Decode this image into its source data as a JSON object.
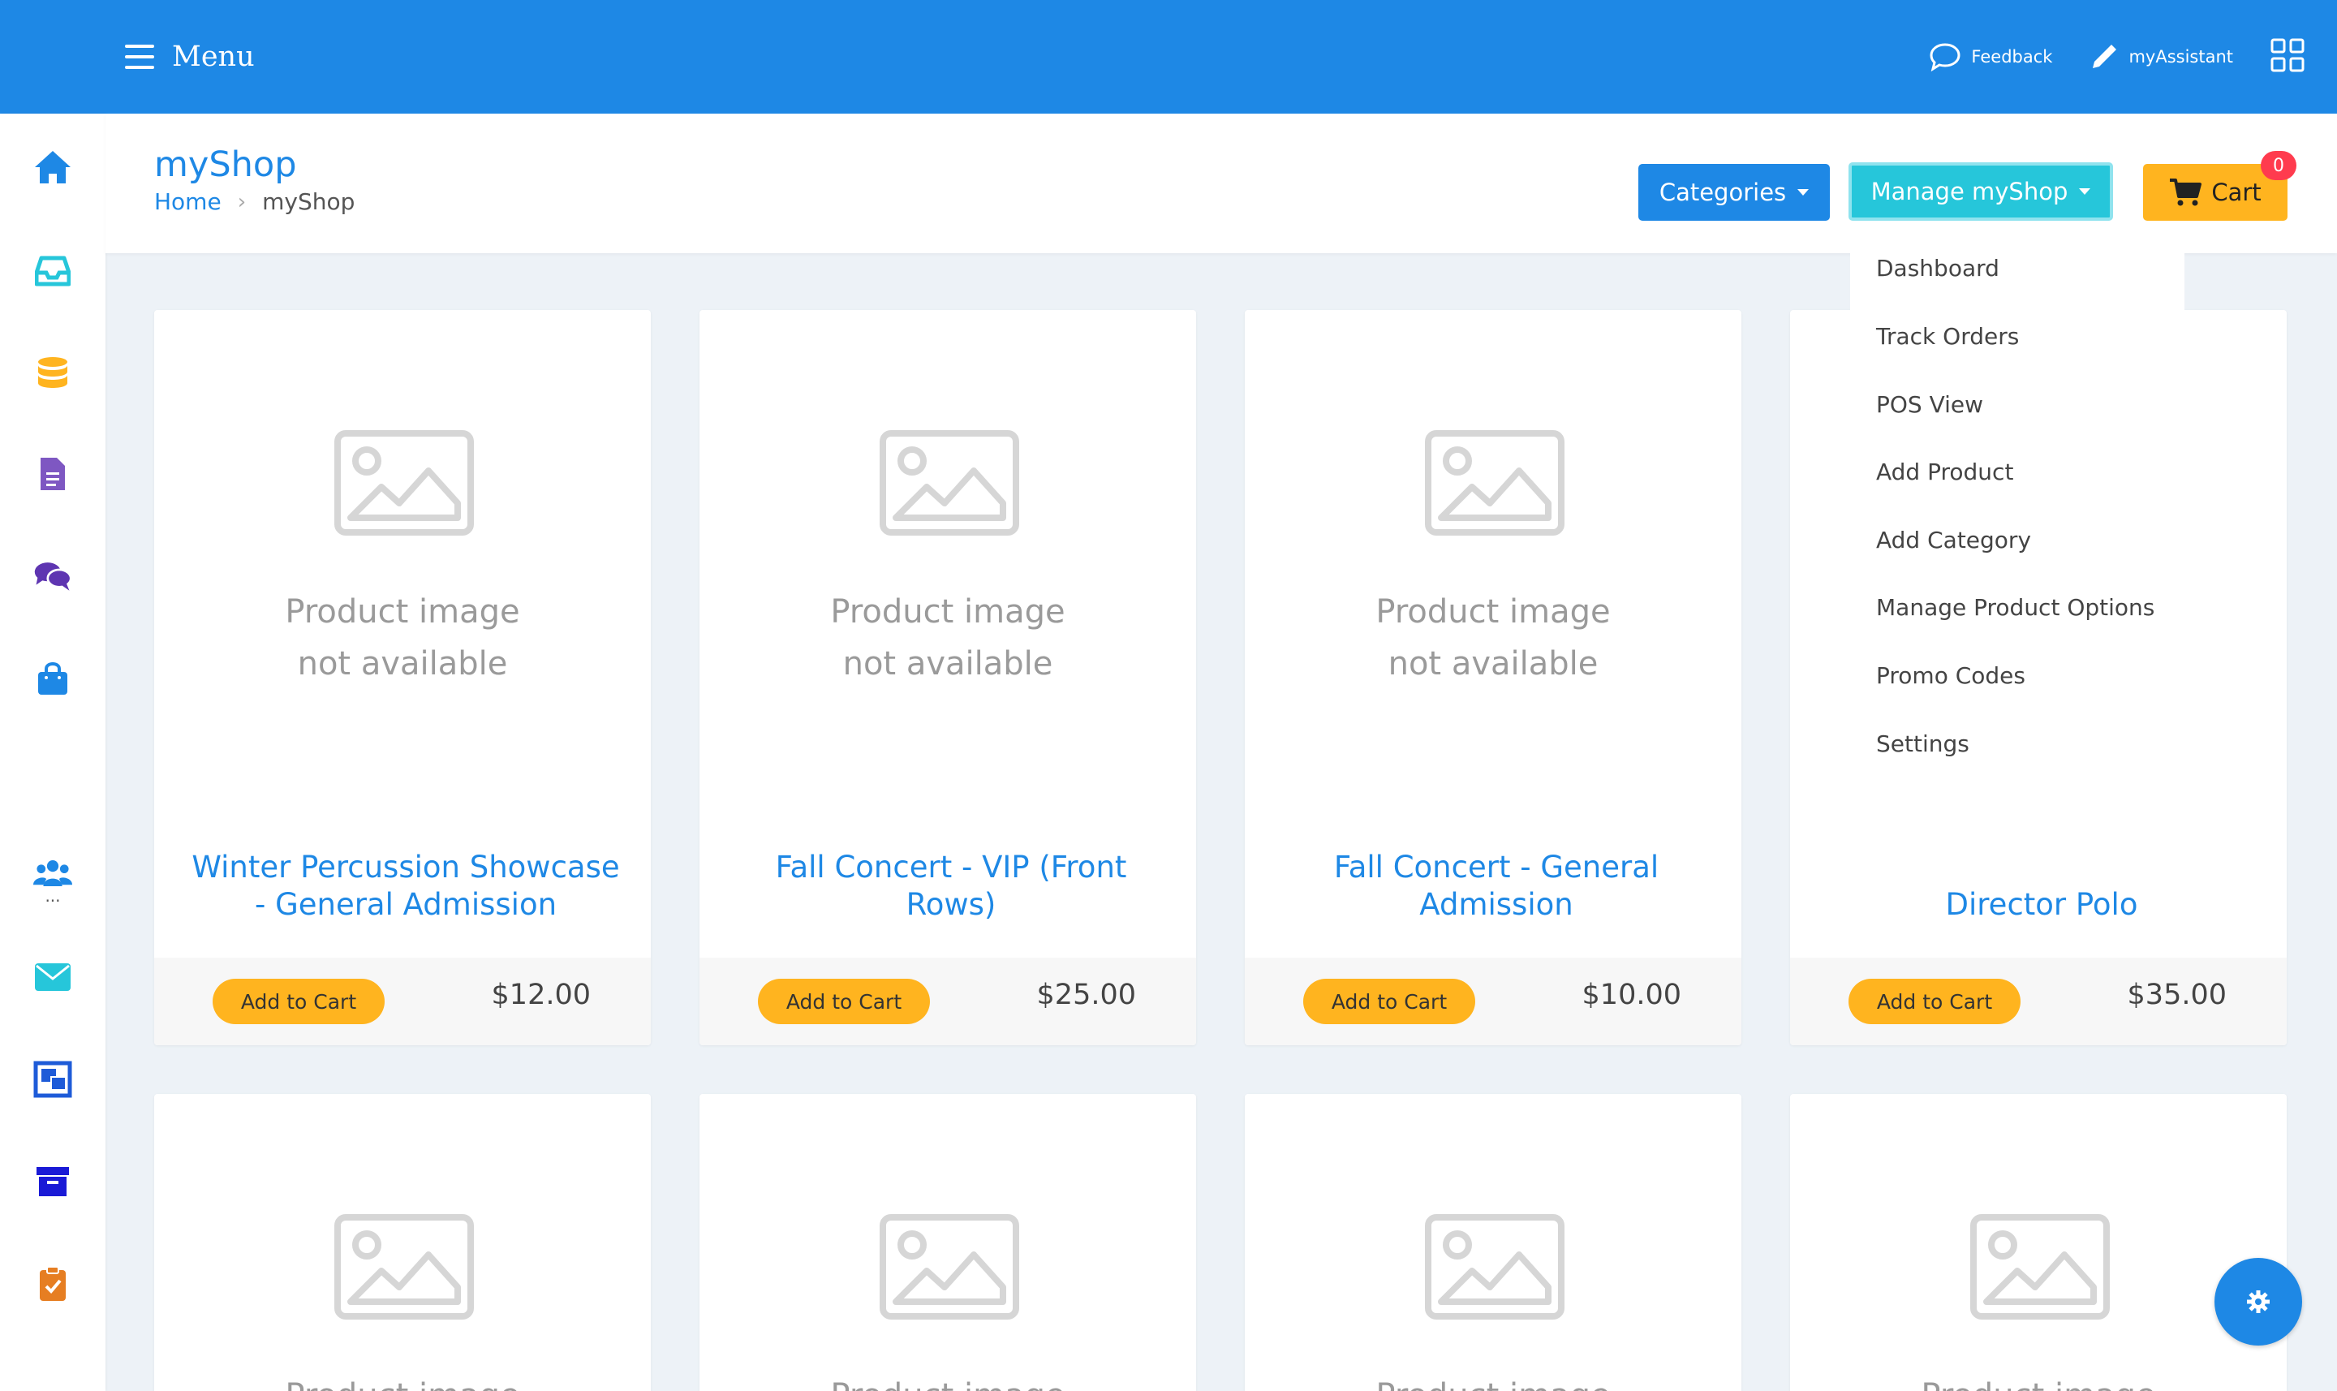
{
  "topbar": {
    "menu_label": "Menu",
    "feedback_label": "Feedback",
    "assistant_label": "myAssistant"
  },
  "sidebar": {
    "items": [
      {
        "icon": "home-icon",
        "color": "#1e88e5"
      },
      {
        "icon": "inbox-icon",
        "color": "#26c6da"
      },
      {
        "icon": "database-icon",
        "color": "#ffb41f"
      },
      {
        "icon": "document-icon",
        "color": "#7e57c2"
      },
      {
        "icon": "chat-icon",
        "color": "#5e35b1"
      },
      {
        "icon": "shopping-bag-icon",
        "color": "#1e88e5"
      },
      {
        "icon": "users-icon",
        "color": "#1e88e5"
      },
      {
        "icon": "envelope-icon",
        "color": "#26c6da"
      },
      {
        "icon": "gallery-icon",
        "color": "#1e5bd8"
      },
      {
        "icon": "archive-icon",
        "color": "#1a1ad6"
      },
      {
        "icon": "clipboard-check-icon",
        "color": "#e67e22"
      }
    ],
    "more_label": "..."
  },
  "header": {
    "title": "myShop",
    "breadcrumb": {
      "home": "Home",
      "current": "myShop"
    },
    "categories_label": "Categories",
    "manage_label": "Manage myShop",
    "cart_label": "Cart",
    "cart_count": "0"
  },
  "manage_menu": {
    "items": [
      "Dashboard",
      "Track Orders",
      "POS View",
      "Add Product",
      "Add Category",
      "Manage Product Options",
      "Promo Codes",
      "Settings"
    ]
  },
  "placeholder": {
    "line1": "Product image",
    "line2": "not available"
  },
  "products": [
    {
      "name": "Winter Percussion Showcase - General Admission",
      "price": "$12.00",
      "button": "Add to Cart"
    },
    {
      "name": "Fall Concert - VIP (Front Rows)",
      "price": "$25.00",
      "button": "Add to Cart"
    },
    {
      "name": "Fall Concert - General Admission",
      "price": "$10.00",
      "button": "Add to Cart"
    },
    {
      "name": "Director Polo",
      "price": "$35.00",
      "button": "Add to Cart"
    }
  ],
  "colors": {
    "primary": "#1e88e5",
    "accent": "#26c6da",
    "warning": "#ffb41f",
    "badge": "#ff3b4e"
  }
}
